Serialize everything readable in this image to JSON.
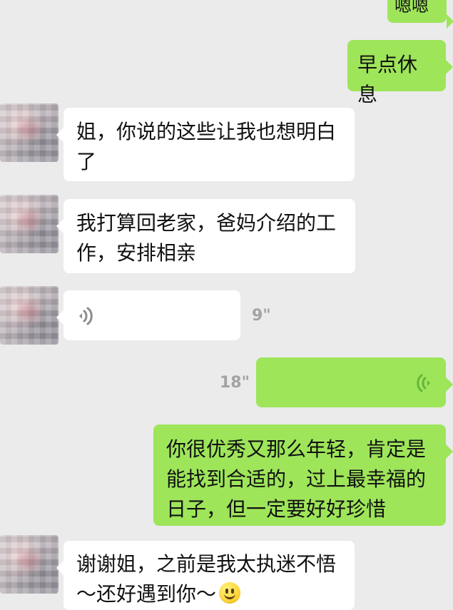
{
  "messages": [
    {
      "id": "m1",
      "side": "right",
      "kind": "text",
      "text": "嗯嗯"
    },
    {
      "id": "m2",
      "side": "right",
      "kind": "text",
      "text": "早点休息"
    },
    {
      "id": "m3",
      "side": "left",
      "kind": "text",
      "text": "姐，你说的这些让我也想明白\n了"
    },
    {
      "id": "m4",
      "side": "left",
      "kind": "text",
      "text": "我打算回老家，爸妈介绍的工\n作，安排相亲"
    },
    {
      "id": "m5",
      "side": "left",
      "kind": "voice",
      "duration": "9\""
    },
    {
      "id": "m6",
      "side": "right",
      "kind": "voice",
      "duration": "18\""
    },
    {
      "id": "m7",
      "side": "right",
      "kind": "text",
      "text": "你很优秀又那么年轻，肯定是\n能找到合适的，过上最幸福的\n日子，但一定要好好珍惜"
    },
    {
      "id": "m8",
      "side": "left",
      "kind": "text",
      "text": "谢谢姐，之前是我太执迷不悟\n～还好遇到你～"
    }
  ],
  "colors": {
    "background": "#ebebeb",
    "left_bubble": "#ffffff",
    "right_bubble": "#9ee55a",
    "voice_icon": "#66b53b",
    "voice_icon_left": "#8d8d8d",
    "duration_text": "#a3a3a3"
  },
  "icons": {
    "voice_left": "voice-wave-icon",
    "voice_right": "voice-wave-icon",
    "emoji": "smile-emoji-icon",
    "avatar": "blurred-avatar"
  }
}
